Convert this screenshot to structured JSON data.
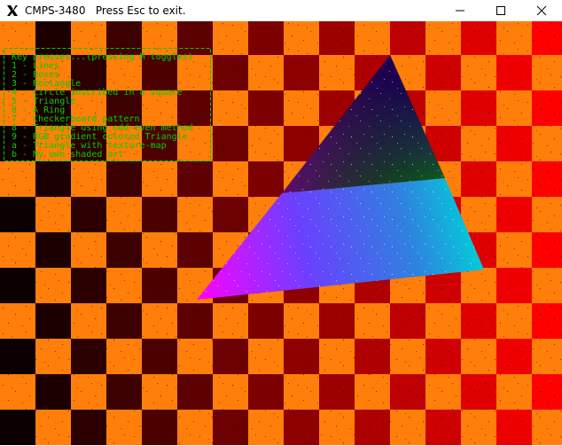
{
  "window": {
    "title": "CMPS-3480   Press Esc to exit.",
    "icon": "x-logo-icon",
    "controls": [
      "minimize-icon",
      "maximize-icon",
      "close-icon"
    ]
  },
  "colors": {
    "orange": "#ff7f0a",
    "menu_text": "#00d000",
    "gradient_top": "#0c0000",
    "gradient_right": "#ff0000",
    "triangle_magenta": "#ff00ff",
    "triangle_blue": "#4020ff",
    "triangle_cyan": "#00d0d8",
    "triangle_green": "#008000"
  },
  "menu": {
    "lines": [
      " Key presses...(pressing M toggles)",
      " 1 - Lines",
      " 2 - Boxes",
      " 3 - Rectangle",
      " 4 - Circle inscribed in a square",
      " 5 - Triangle",
      " 6 - A Ring",
      " 7 - Checkerboard pattern",
      " 8 - Triangle using odd-even method",
      " 9 - RGB gradient colored Triangle",
      " a - Triangle with texture-map",
      " b - My own shaded art"
    ]
  }
}
